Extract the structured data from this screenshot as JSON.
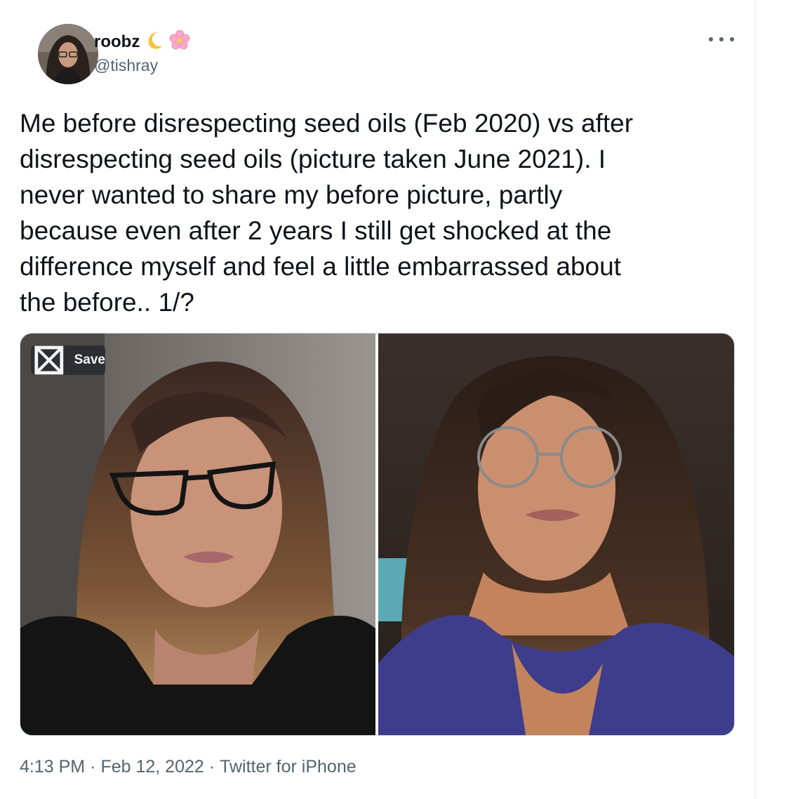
{
  "author": {
    "display_name": "roobz",
    "handle": "@tishray",
    "emojis": [
      "crescent-moon",
      "cherry-blossom"
    ]
  },
  "tweet": {
    "lines": [
      "Me before disrespecting seed oils (Feb 2020) vs after",
      "disrespecting seed oils (picture taken June 2021). I",
      "never wanted to share my before picture, partly",
      "because even after 2 years I still get shocked at the",
      "difference myself and feel a little embarrassed about",
      "the before.. 1/?"
    ]
  },
  "media": {
    "save_label": "Save",
    "save_icon": "save-icon"
  },
  "meta": {
    "time": "4:13 PM",
    "date": "Feb 12, 2022",
    "source": "Twitter for iPhone",
    "separator": "·"
  },
  "colors": {
    "text_primary": "#0f1419",
    "text_secondary": "#536471",
    "border": "#cfd9de",
    "save_button_bg": "#2b2e33"
  }
}
